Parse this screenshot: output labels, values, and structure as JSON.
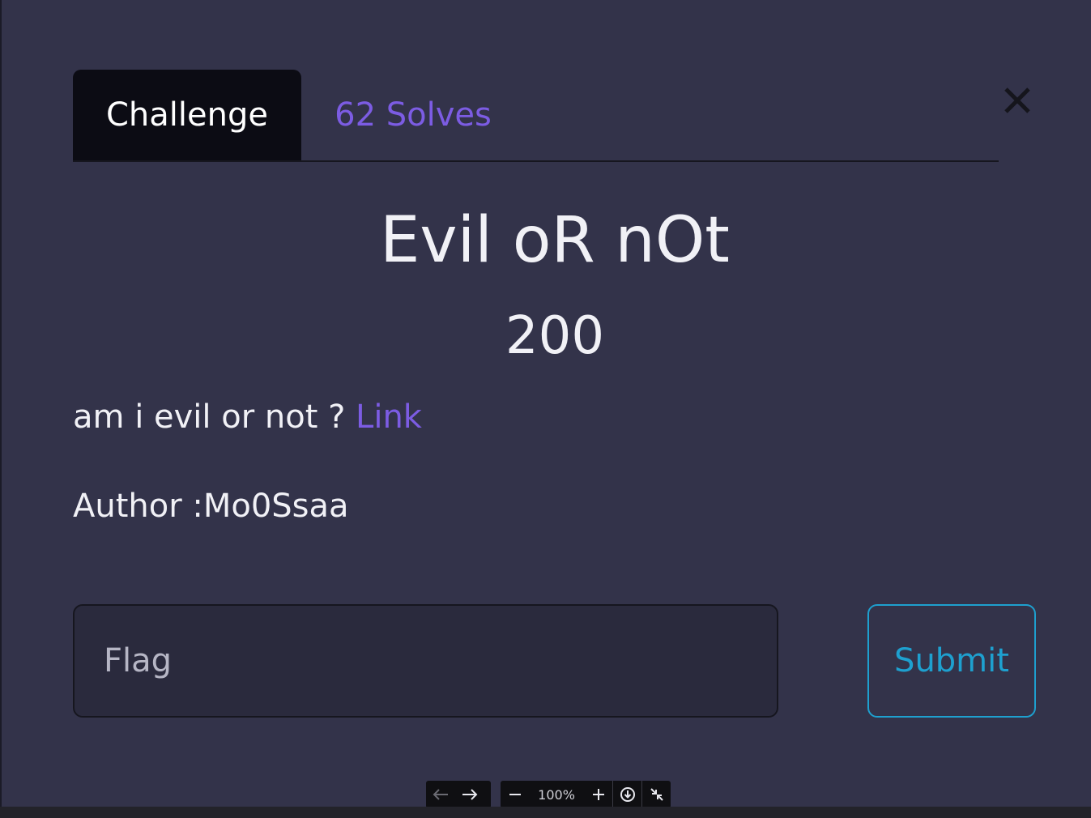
{
  "tabs": {
    "challenge_label": "Challenge",
    "solves_label": "62 Solves"
  },
  "challenge": {
    "title": "Evil oR nOt",
    "points": "200",
    "description": "am i evil or not ?",
    "link_label": "Link",
    "author": "Author :Mo0Ssaa"
  },
  "form": {
    "flag_placeholder": "Flag",
    "flag_value": "",
    "submit_label": "Submit"
  },
  "viewer_toolbar": {
    "zoom_level": "100%"
  },
  "icons": {
    "close": "close-icon",
    "back": "arrow-left-icon",
    "forward": "arrow-right-icon",
    "zoom_out": "minus-icon",
    "zoom_in": "plus-icon",
    "download": "download-icon",
    "exit_fullscreen": "collapse-icon"
  },
  "colors": {
    "background": "#33334a",
    "active_tab": "#0c0c14",
    "accent_purple": "#7c5ce3",
    "submit_blue": "#1ea0cf"
  }
}
